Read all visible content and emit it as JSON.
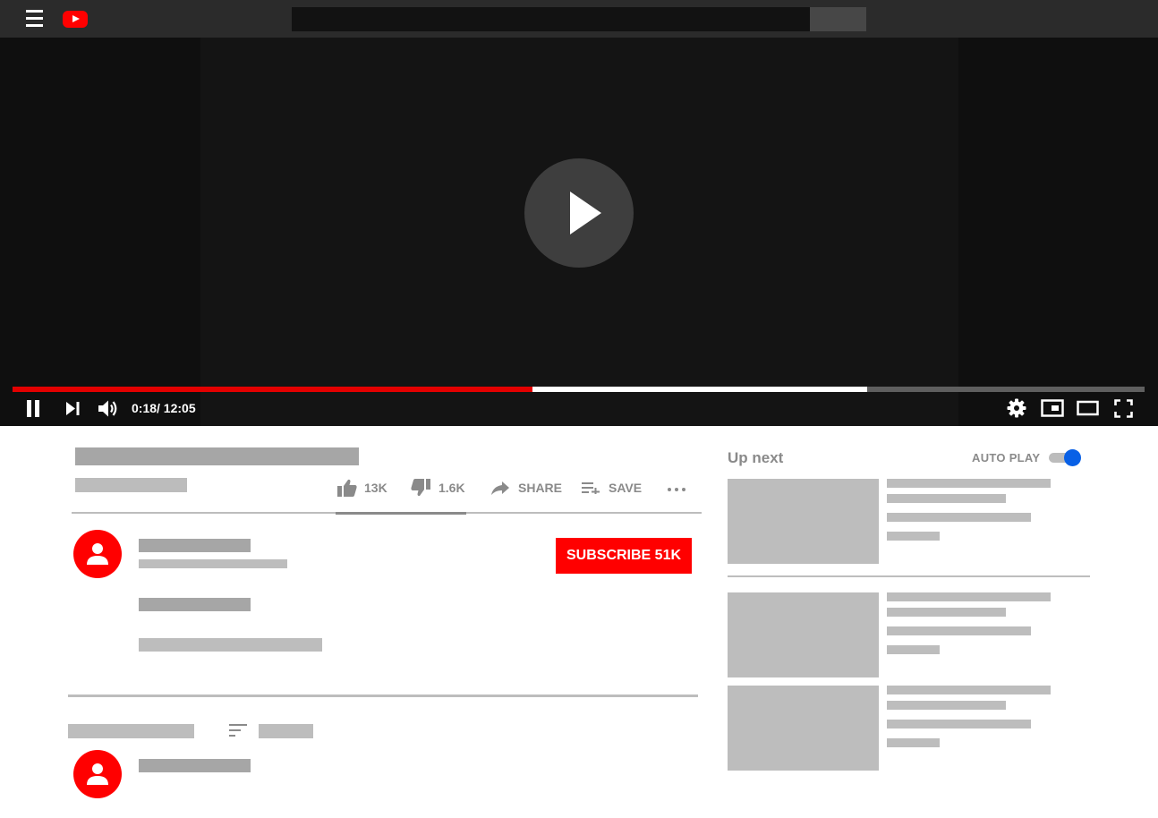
{
  "header": {
    "menu_icon": "hamburger-menu-icon",
    "logo_icon": "youtube-logo-icon",
    "search": {
      "value": "",
      "placeholder": ""
    },
    "colors": {
      "bar": "#2b2b2b",
      "logo": "#ff0000"
    }
  },
  "player": {
    "state": "paused",
    "current_time": "0:18",
    "duration": "12:05",
    "time_display": "0:18/ 12:05",
    "progress": {
      "played_fraction": 0.459,
      "buffered_fraction": 0.755
    },
    "controls": {
      "left": [
        "pause-icon",
        "next-icon",
        "volume-icon"
      ],
      "right": [
        "settings-icon",
        "miniplayer-icon",
        "theater-mode-icon",
        "fullscreen-icon"
      ]
    },
    "colors": {
      "played": "#e30000",
      "buffered": "#ffffff",
      "track": "#5f5f5f"
    }
  },
  "video_actions": {
    "like_count": "13K",
    "dislike_count": "1.6K",
    "share_label": "SHARE",
    "save_label": "SAVE",
    "more_icon": "more-options-icon"
  },
  "channel": {
    "subscribe_label": "SUBSCRIBE 51K",
    "avatar_icon": "user-avatar-icon",
    "colors": {
      "subscribe": "#ff0000"
    }
  },
  "comments": {
    "sort_icon": "sort-icon",
    "avatar_icon": "user-avatar-icon"
  },
  "sidebar": {
    "up_next_label": "Up next",
    "autoplay_label": "AUTO PLAY",
    "autoplay_on": true,
    "colors": {
      "toggle_knob": "#0860e6"
    }
  }
}
